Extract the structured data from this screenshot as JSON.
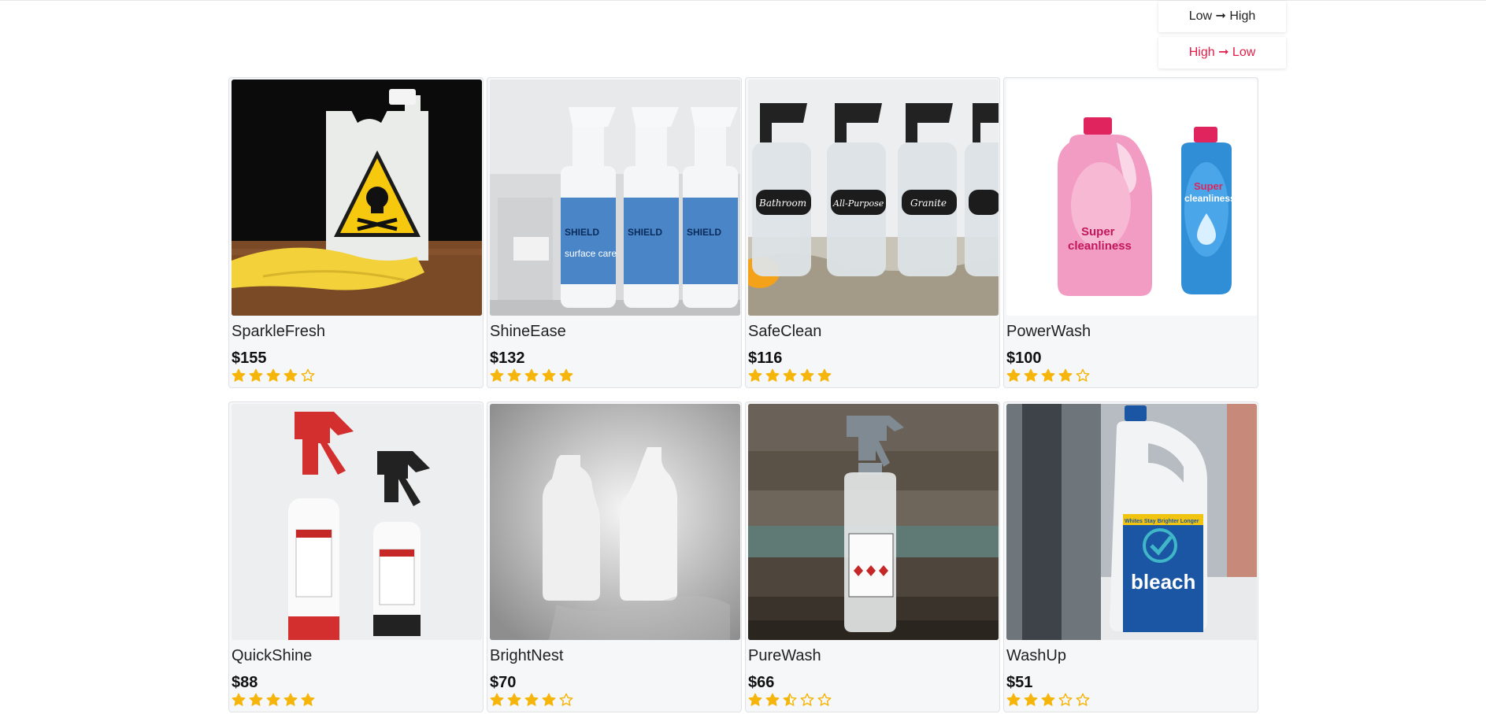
{
  "sort": {
    "options": [
      {
        "label": "Low ➞ High",
        "active": false
      },
      {
        "label": "High ➞ Low",
        "active": true
      }
    ]
  },
  "colors": {
    "accent": "#e11d48",
    "star": "#f5b50a"
  },
  "products": [
    {
      "name": "SparkleFresh",
      "price": "$155",
      "rating": 4,
      "image": "toxic-jug-with-gloves"
    },
    {
      "name": "ShineEase",
      "price": "$132",
      "rating": 5,
      "image": "shield-spray-bottles"
    },
    {
      "name": "SafeClean",
      "price": "$116",
      "rating": 5,
      "image": "labeled-glass-spray-bottles"
    },
    {
      "name": "PowerWash",
      "price": "$100",
      "rating": 4,
      "image": "pink-and-blue-detergent-bottles"
    },
    {
      "name": "QuickShine",
      "price": "$88",
      "rating": 5,
      "image": "red-and-black-trigger-sprayers"
    },
    {
      "name": "BrightNest",
      "price": "$70",
      "rating": 4,
      "image": "white-plastic-bottles"
    },
    {
      "name": "PureWash",
      "price": "$66",
      "rating": 2.5,
      "image": "gray-trigger-spray-bottle"
    },
    {
      "name": "WashUp",
      "price": "$51",
      "rating": 3,
      "image": "bleach-jug"
    }
  ],
  "image_text": {
    "shield": "SHIELD",
    "surface": "surface care",
    "bathroom": "Bathroom",
    "allpurpose": "All-Purpose",
    "granite": "Granite",
    "super": "Super",
    "cleanliness": "cleanliness",
    "bleach": "bleach",
    "brighter": "Whites Stay Brighter Longer"
  }
}
